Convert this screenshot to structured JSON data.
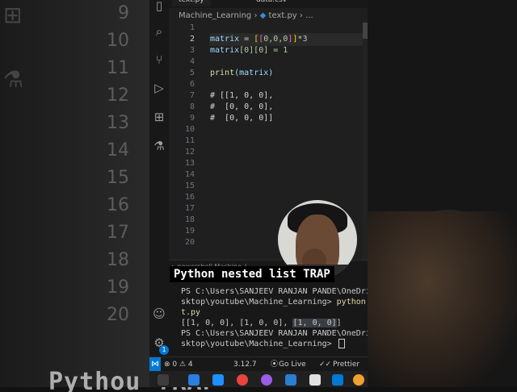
{
  "background": {
    "left_line_numbers": [
      "9",
      "10",
      "11",
      "12",
      "13",
      "14",
      "15",
      "16",
      "17",
      "18",
      "19",
      "20"
    ],
    "bottom_caption": "Pythou                                      TRAP"
  },
  "editor": {
    "tabs": [
      "text.py",
      "data.csv"
    ],
    "breadcrumb": {
      "folder": "Machine_Learning",
      "separator": "›",
      "file": "text.py",
      "more": "› ..."
    },
    "line_numbers": [
      "1",
      "2",
      "3",
      "4",
      "5",
      "6",
      "7",
      "8",
      "9",
      "10",
      "11",
      "12",
      "13",
      "14",
      "15",
      "16",
      "17",
      "18",
      "19",
      "20"
    ],
    "current_line": 2,
    "code": {
      "line2": {
        "var": "matrix",
        "eq": " = ",
        "open": "[",
        "inner_open": "[",
        "inner_vals": "0,0,0",
        "inner_close": "]",
        "close": "]",
        "mult": "*3"
      },
      "line3": {
        "var": "matrix",
        "idx": "[0][0]",
        "assign": " = 1"
      },
      "line5": {
        "fn": "print",
        "arg": "(matrix)"
      },
      "line7": "# [[1, 0, 0],",
      "line8": "#  [0, 0, 0],",
      "line9": "#  [0, 0, 0]]"
    }
  },
  "terminal": {
    "tabs": "▸ powershell  Machine_L",
    "lines": {
      "l1": "PS C:\\Users\\SANJEEV RANJAN PANDE\\OneDrive\\De",
      "l2_prefix": "sktop\\youtube\\Machine_Learning> ",
      "l2_cmd": "python .\\tex",
      "l3": "t.py",
      "l4_pre": "[[1, 0, 0], [1, 0, 0], ",
      "l4_sel": "[1, 0, 0]",
      "l4_post": "]",
      "l5": "PS C:\\Users\\SANJEEV RANJAN PANDE\\OneDrive\\De",
      "l6": "sktop\\youtube\\Machine_Learning> "
    }
  },
  "statusbar": {
    "problems": "⊗ 0 ⚠ 4",
    "python_version": "3.12.7",
    "go_live": "Go Live",
    "prettier": "Prettier",
    "remote_icon": "remote-icon"
  },
  "activity": {
    "accounts_badge": "1",
    "icons": [
      "files-icon",
      "search-icon",
      "source-control-icon",
      "run-debug-icon",
      "extensions-icon",
      "testing-icon",
      "account-icon",
      "gear-icon"
    ]
  },
  "overlay": {
    "caption": "Python nested list TRAP"
  },
  "colors": {
    "accent": "#0078d4",
    "editor_bg": "#1f1f1f",
    "comment": "#6a9955"
  }
}
